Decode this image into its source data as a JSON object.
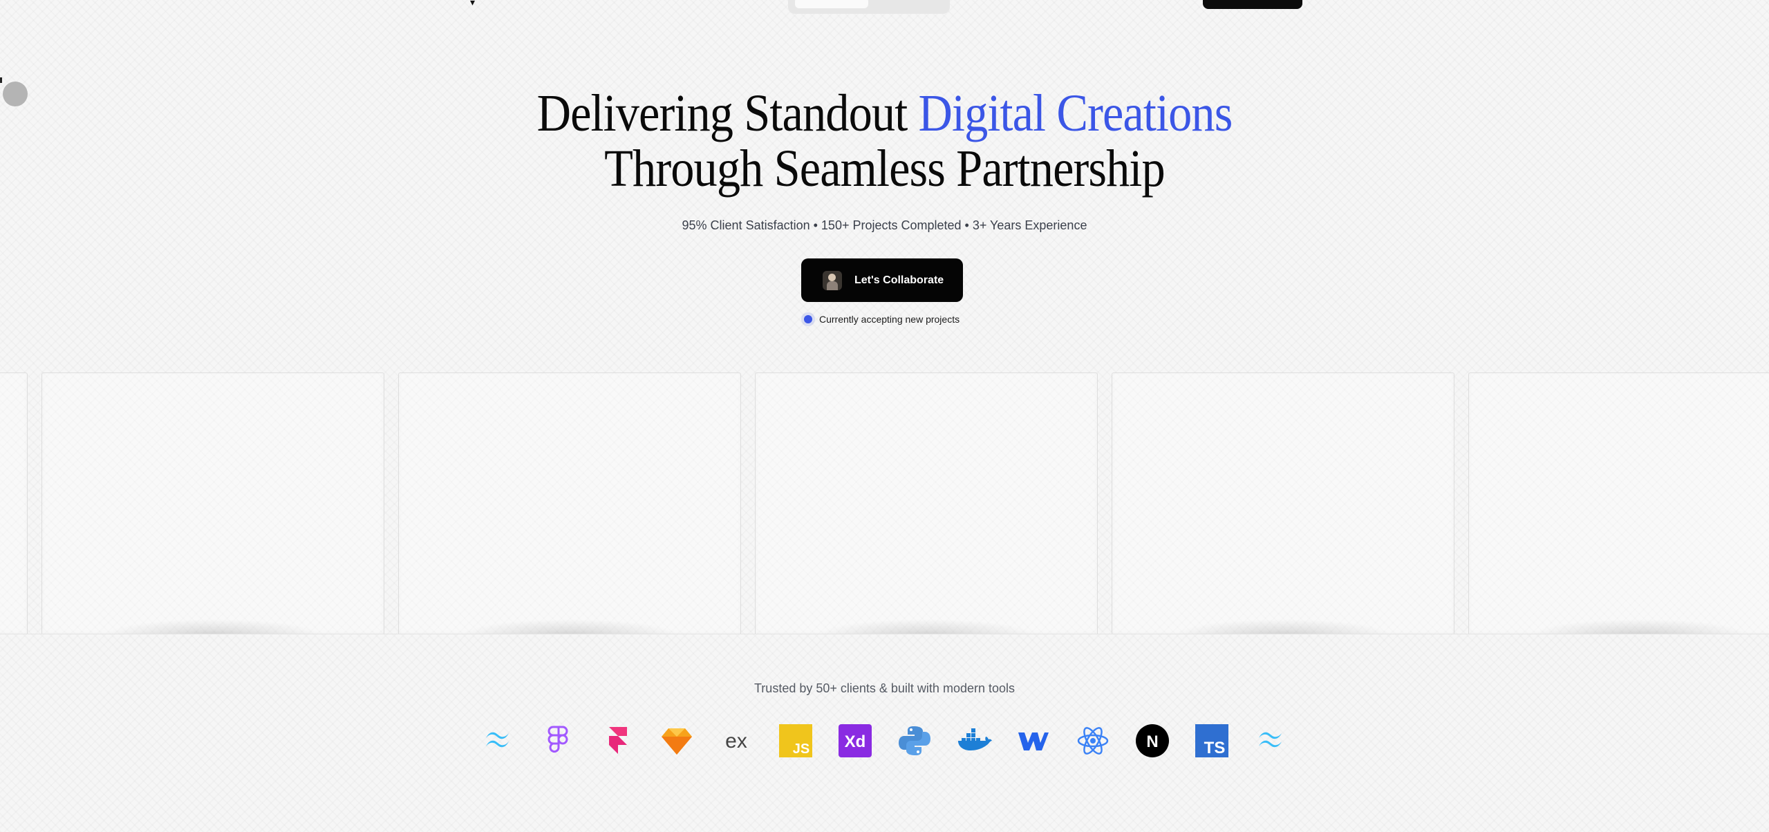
{
  "nav": {
    "logo_glyph": "▾"
  },
  "hero": {
    "title_line1_plain": "Delivering Standout ",
    "title_line1_accent": "Digital Creations",
    "title_line2": "Through Seamless Partnership",
    "stats": "95% Client Satisfaction • 150+ Projects Completed • 3+ Years Experience",
    "cta_label": "Let's Collaborate",
    "status_text": "Currently accepting new projects"
  },
  "colors": {
    "accent": "#3b56e6",
    "cta_bg": "#050505",
    "background": "#f6f6f6"
  },
  "footer": {
    "trusted_text": "Trusted by 50+ clients & built with modern tools",
    "tools": [
      "tailwind-icon",
      "figma-icon",
      "framer-icon",
      "sketch-icon",
      "express-icon",
      "javascript-icon",
      "adobe-xd-icon",
      "python-icon",
      "docker-icon",
      "webflow-icon",
      "react-icon",
      "nextjs-icon",
      "typescript-icon",
      "tailwind-icon"
    ],
    "tool_texts": {
      "express": "ex",
      "javascript": "JS",
      "adobe_xd": "Xd",
      "nextjs": "N",
      "typescript": "TS"
    }
  }
}
